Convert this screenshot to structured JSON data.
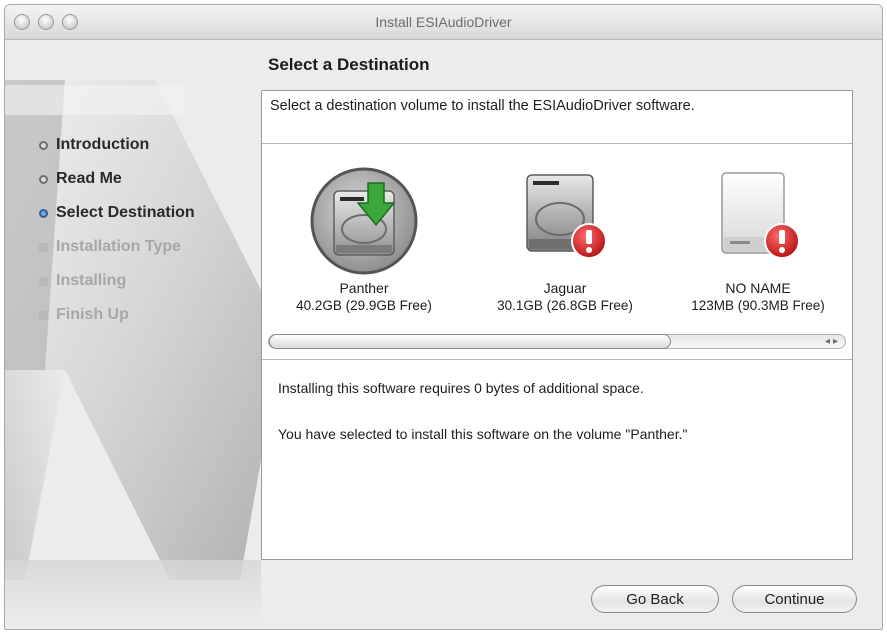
{
  "window": {
    "title": "Install ESIAudioDriver"
  },
  "sidebar": {
    "steps": [
      {
        "label": "Introduction",
        "state": "done"
      },
      {
        "label": "Read Me",
        "state": "done"
      },
      {
        "label": "Select Destination",
        "state": "current"
      },
      {
        "label": "Installation Type",
        "state": "upcoming"
      },
      {
        "label": "Installing",
        "state": "upcoming"
      },
      {
        "label": "Finish Up",
        "state": "upcoming"
      }
    ]
  },
  "main": {
    "heading": "Select a Destination",
    "intro": "Select a destination volume to install the ESIAudioDriver software.",
    "volumes": [
      {
        "name": "Panther",
        "size": "40.2GB (29.9GB Free)",
        "icon": "hard-drive-install-icon",
        "selected": true
      },
      {
        "name": "Jaguar",
        "size": "30.1GB (26.8GB Free)",
        "icon": "hard-drive-warning-icon",
        "selected": false
      },
      {
        "name": "NO NAME",
        "size": "123MB (90.3MB Free)",
        "icon": "removable-drive-warning-icon",
        "selected": false
      }
    ],
    "space_required": "Installing this software requires 0 bytes of additional space.",
    "selection_status": "You have selected to install this software on the volume \"Panther.\""
  },
  "buttons": {
    "go_back": "Go Back",
    "continue": "Continue"
  },
  "colors": {
    "install_arrow": "#3aa83a",
    "warning_badge": "#d42020",
    "current_step": "#2f5f9b"
  }
}
